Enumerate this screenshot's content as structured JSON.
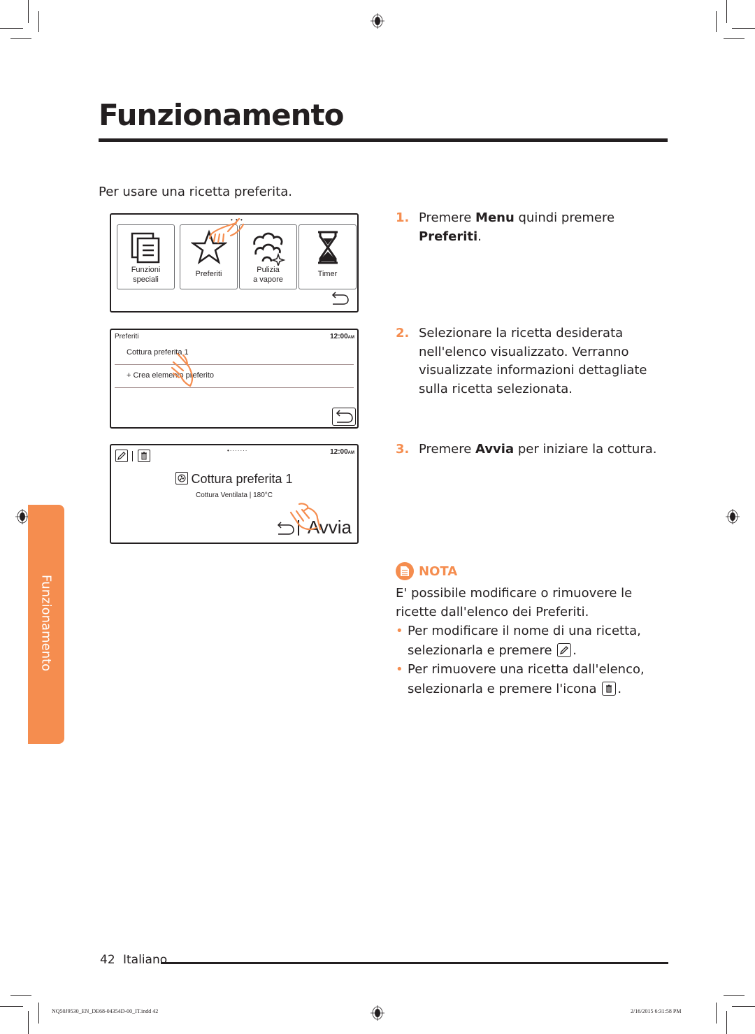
{
  "header": {
    "title": "Funzionamento"
  },
  "intro": "Per usare una ricetta preferita.",
  "screens": {
    "menu": {
      "tiles": [
        {
          "icon": "documents-icon",
          "label": "Funzioni\nspeciali"
        },
        {
          "icon": "star-icon",
          "label": "Preferiti"
        },
        {
          "icon": "steam-clean-icon",
          "label": "Pulizia\na vapore"
        },
        {
          "icon": "hourglass-icon",
          "label": "Timer"
        }
      ],
      "page_dots": "• • •"
    },
    "favorites": {
      "title": "Preferiti",
      "clock": "12:00",
      "clock_suffix": "AM",
      "items": [
        {
          "label": "Cottura preferita 1"
        },
        {
          "label": "+   Crea elemento preferito"
        }
      ]
    },
    "recipe": {
      "page_dots": "•·······",
      "clock": "12:00",
      "clock_suffix": "AM",
      "name": "Cottura preferita 1",
      "details": "Cottura Ventilata | 180°C",
      "start_label": "Avvia"
    }
  },
  "steps": [
    {
      "num": "1.",
      "parts": [
        "Premere ",
        "Menu",
        " quindi premere ",
        "Preferiti",
        "."
      ]
    },
    {
      "num": "2.",
      "text": "Selezionare la ricetta desiderata nell'elenco visualizzato. Verranno visualizzate informazioni dettagliate sulla ricetta selezionata."
    },
    {
      "num": "3.",
      "parts": [
        "Premere ",
        "Avvia",
        " per iniziare la cottura."
      ]
    }
  ],
  "note": {
    "label": "NOTA",
    "body": "E' possibile modificare o rimuovere le ricette dall'elenco dei Preferiti.",
    "bullets": [
      {
        "text_before": "Per modificare il nome di una ricetta, selezionarla e premere ",
        "icon": "edit-icon",
        "text_after": "."
      },
      {
        "text_before": "Per rimuovere una ricetta dall'elenco, selezionarla e premere l'icona ",
        "icon": "trash-icon",
        "text_after": "."
      }
    ]
  },
  "side_tab": {
    "label": "Funzionamento"
  },
  "footer": {
    "page_number": "42",
    "language": "Italiano",
    "slug_file": "NQ50J9530_EN_DE68-04354D-00_IT.indd   42",
    "slug_date": "2/16/2015   6:31:58 PM"
  },
  "colors": {
    "accent": "#f58d4f",
    "text": "#231f20"
  }
}
